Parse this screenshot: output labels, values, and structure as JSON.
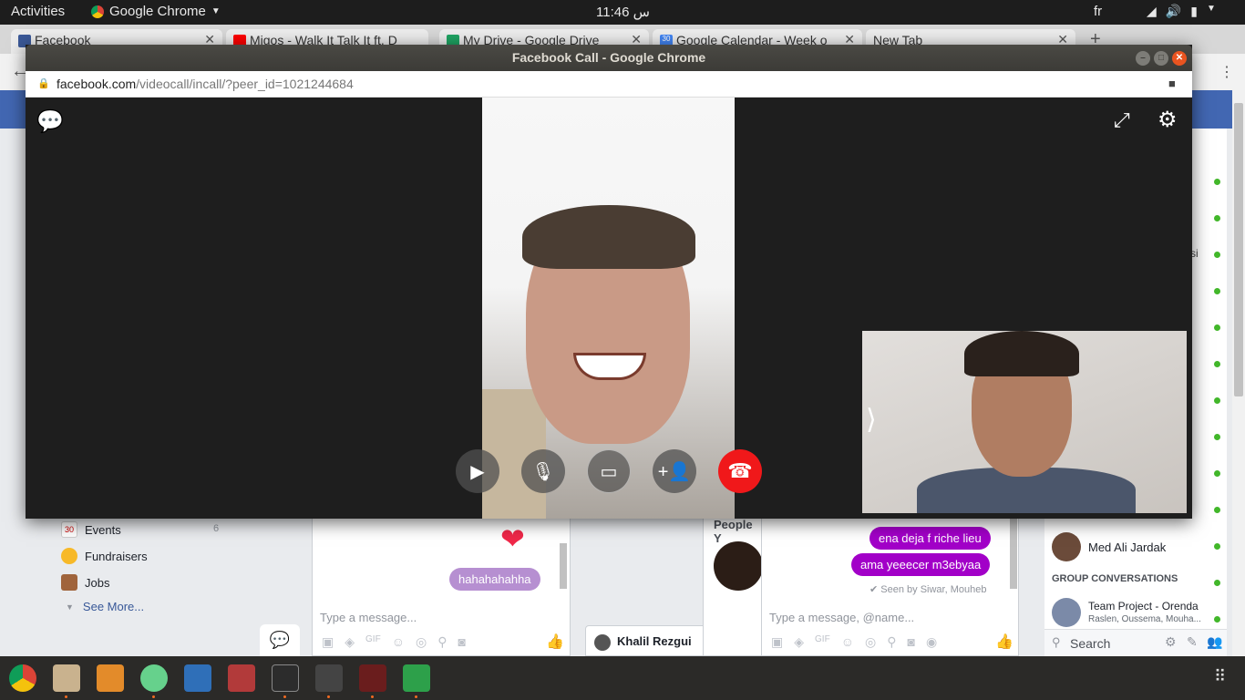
{
  "topbar": {
    "activities": "Activities",
    "app_name": "Google Chrome",
    "clock": "11:46 س",
    "language": "fr"
  },
  "tabs": [
    {
      "label": "Facebook",
      "color": "#3b5998"
    },
    {
      "label": "Migos - Walk It Talk It ft. D",
      "color": "#ff0000"
    },
    {
      "label": "My Drive - Google Drive",
      "color": "#1fa463"
    },
    {
      "label": "Google Calendar - Week o",
      "color": "#4285f4",
      "badge": "30"
    },
    {
      "label": "New Tab",
      "color": "#ececec"
    }
  ],
  "call_window": {
    "title": "Facebook Call - Google Chrome",
    "url_host": "facebook.com",
    "url_path": "/videocall/incall/?peer_id=1021244684"
  },
  "sidebar": {
    "items": [
      {
        "label": "Events",
        "count": "6",
        "icon": "calendar-icon",
        "badge": "30"
      },
      {
        "label": "Fundraisers",
        "count": "",
        "icon": "fundraiser-icon"
      },
      {
        "label": "Jobs",
        "count": "",
        "icon": "briefcase-icon"
      }
    ],
    "see_more": "See More..."
  },
  "chat_left": {
    "messages": [
      "hahahahahha"
    ],
    "input_placeholder": "Type a message..."
  },
  "chat_tab_khalil": {
    "name": "Khalil Rezgui"
  },
  "chat_right": {
    "header_fragment": "People Y",
    "messages": [
      "ena deja f riche lieu",
      "ama yeeecer m3ebyaa"
    ],
    "seen": "Seen by Siwar, Mouheb",
    "input_placeholder": "Type a message, @name..."
  },
  "contacts": {
    "truncated_name": "si",
    "med_ali": "Med Ali Jardak",
    "group_header": "GROUP CONVERSATIONS",
    "team_title": "Team Project - Orenda",
    "team_members": "Raslen, Oussema, Mouha...",
    "search_placeholder": "Search"
  },
  "colors": {
    "fb_blue": "#4267b2",
    "bubble_purple": "#a200c8",
    "bubble_light": "#b68fd1",
    "end_call": "#f0181a",
    "online_green": "#42b72a"
  }
}
